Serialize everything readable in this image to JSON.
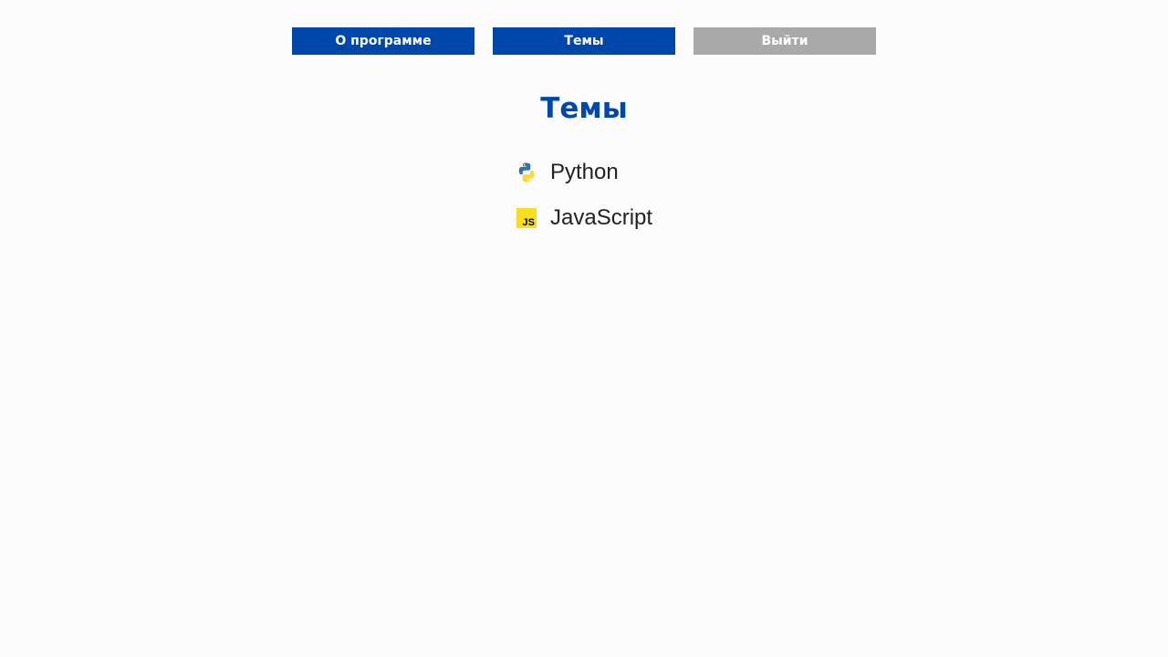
{
  "nav": {
    "about_label": "О программе",
    "topics_label": "Темы",
    "exit_label": "Выйти"
  },
  "page": {
    "title": "Темы"
  },
  "topics": [
    {
      "label": "Python",
      "icon": "python-icon"
    },
    {
      "label": "JavaScript",
      "icon": "javascript-icon",
      "icon_text": "JS"
    }
  ],
  "colors": {
    "primary": "#0047ab",
    "muted": "#a9a9a9",
    "background": "#fcfcfc",
    "text": "#222222",
    "js_yellow": "#f7df1e",
    "python_blue": "#3572a5",
    "python_yellow": "#ffd43b"
  }
}
